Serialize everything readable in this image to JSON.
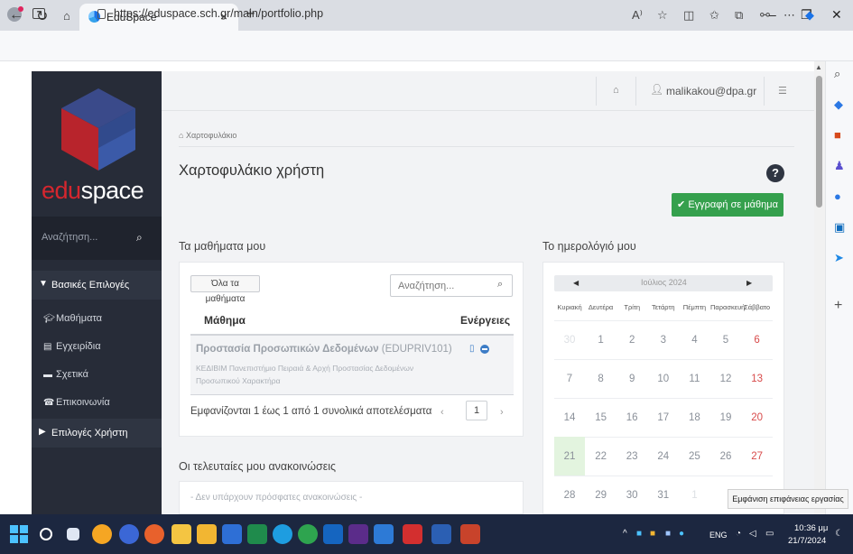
{
  "browser": {
    "tab_title": "EduSpace",
    "tab_close": "×",
    "new_tab": "+",
    "url": "https://eduspace.sch.gr/main/portfolio.php",
    "win_min": "–",
    "win_restore": "❐",
    "win_close": "✕"
  },
  "sidebar": {
    "brand_edu": "edu",
    "brand_space": "space",
    "search_placeholder": "Αναζήτηση...",
    "section_basic": "Βασικές Επιλογές",
    "items": [
      {
        "label": "Μαθήματα",
        "icon": "graduation-cap-icon"
      },
      {
        "label": "Εγχειρίδια",
        "icon": "book-icon"
      },
      {
        "label": "Σχετικά",
        "icon": "credit-card-icon"
      },
      {
        "label": "Επικοινωνία",
        "icon": "phone-icon"
      }
    ],
    "section_user": "Επιλογές Χρήστη"
  },
  "topbar": {
    "user": "malikakou@dpa.gr"
  },
  "page": {
    "breadcrumb": "Χαρτοφυλάκιο",
    "title": "Χαρτοφυλάκιο χρήστη",
    "help": "?",
    "enroll_button": "Εγγραφή σε μάθημα"
  },
  "courses": {
    "section_title": "Τα μαθήματα μου",
    "filter_button": "Όλα τα μαθήματα",
    "search_placeholder": "Αναζήτηση...",
    "col_course": "Μάθημα",
    "col_actions": "Ενέργειες",
    "rows": [
      {
        "name": "Προστασία Προσωπικών Δεδομένων",
        "code": "(EDUPRIV101)",
        "desc": "ΚΕΔΙΒΙΜ Πανεπιστήμιο Πειραιά & Αρχή Προστασίας Δεδομένων Προσωπικού Χαρακτήρα"
      }
    ],
    "results": "Εμφανίζονται 1 έως 1 από 1 συνολικά αποτελέσματα",
    "page": "1"
  },
  "announcements": {
    "section_title": "Οι τελευταίες μου ανακοινώσεις",
    "empty": "- Δεν υπάρχουν πρόσφατες ανακοινώσεις -"
  },
  "calendar": {
    "section_title": "Το ημερολόγιό μου",
    "month": "Ιούλιος 2024",
    "days_of_week": [
      "Κυριακή",
      "Δευτέρα",
      "Τρίτη",
      "Τετάρτη",
      "Πέμπτη",
      "Παρασκευή",
      "Σάββατο"
    ],
    "weeks": [
      [
        "30",
        "1",
        "2",
        "3",
        "4",
        "5",
        "6"
      ],
      [
        "7",
        "8",
        "9",
        "10",
        "11",
        "12",
        "13"
      ],
      [
        "14",
        "15",
        "16",
        "17",
        "18",
        "19",
        "20"
      ],
      [
        "21",
        "22",
        "23",
        "24",
        "25",
        "26",
        "27"
      ],
      [
        "28",
        "29",
        "30",
        "31",
        "1",
        "",
        ""
      ]
    ],
    "today": "21"
  },
  "tooltip": "Εμφάνιση επιφάνειας εργασίας",
  "taskbar": {
    "tray_lang": "ENG",
    "time": "10:36 μμ",
    "date": "21/7/2024"
  },
  "colors": {
    "sidebar_bg": "#272c38",
    "brand_red": "#d6262e",
    "enroll_green": "#35a04d",
    "link_blue": "#3c7cc6",
    "taskbar_bg": "#1c2740"
  }
}
